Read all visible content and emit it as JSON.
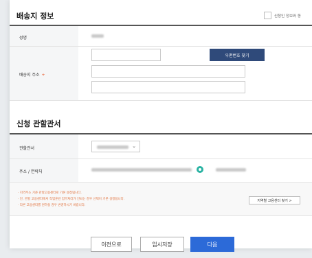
{
  "delivery": {
    "title": "배송지 정보",
    "same_as_applicant_label": "신청인 정보와 동",
    "name_label": "성명",
    "address_label": "배송지 주소",
    "required_mark": "+",
    "postal_button": "우편번호 찾기"
  },
  "office": {
    "title": "신청 관할관서",
    "office_label": "관할관서",
    "address_contact_label": "주소 / 연락처",
    "notes": [
      "· 지역주소 기준 관할고용센터로 기본 설정됩니다.",
      "· 단, 관할 고용센터에서 직업훈련 업무처리가 안되는 경우 선택이 기본 설정됩니다.",
      "· 다른 고용센터를 원하실 경우 변경하시기 바랍니다."
    ],
    "region_button": "지역별 고용센터 찾기 >"
  },
  "footer": {
    "prev_label": "이전으로",
    "temp_save_label": "임시저장",
    "next_label": "다음"
  }
}
